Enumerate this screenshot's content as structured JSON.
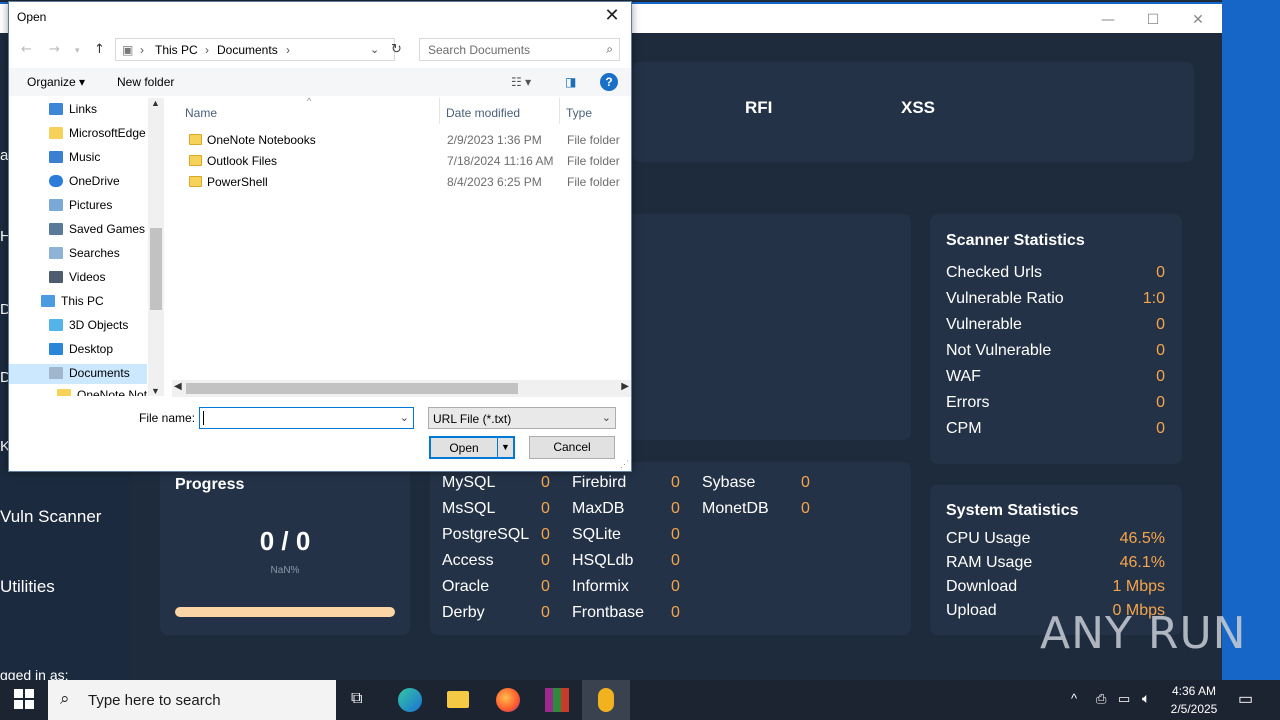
{
  "dialog": {
    "title": "Open",
    "address": [
      "This PC",
      "Documents"
    ],
    "search_placeholder": "Search Documents",
    "toolbar": {
      "organize": "Organize",
      "new_folder": "New folder"
    },
    "tree": [
      {
        "label": "Links",
        "icon": "links-icon"
      },
      {
        "label": "MicrosoftEdge",
        "icon": "folder-icon"
      },
      {
        "label": "Music",
        "icon": "music-icon"
      },
      {
        "label": "OneDrive",
        "icon": "onedrive-icon"
      },
      {
        "label": "Pictures",
        "icon": "pictures-icon"
      },
      {
        "label": "Saved Games",
        "icon": "saved-games-icon"
      },
      {
        "label": "Searches",
        "icon": "searches-icon"
      },
      {
        "label": "Videos",
        "icon": "videos-icon"
      },
      {
        "label": "This PC",
        "icon": "this-pc-icon"
      },
      {
        "label": "3D Objects",
        "icon": "3d-objects-icon"
      },
      {
        "label": "Desktop",
        "icon": "desktop-icon"
      },
      {
        "label": "Documents",
        "icon": "documents-icon"
      },
      {
        "label": "OneNote Not",
        "icon": "folder-icon"
      }
    ],
    "columns": {
      "name": "Name",
      "date": "Date modified",
      "type": "Type"
    },
    "files": [
      {
        "name": "OneNote Notebooks",
        "date": "2/9/2023 1:36 PM",
        "type": "File folder"
      },
      {
        "name": "Outlook Files",
        "date": "7/18/2024 11:16 AM",
        "type": "File folder"
      },
      {
        "name": "PowerShell",
        "date": "8/4/2023 6:25 PM",
        "type": "File folder"
      }
    ],
    "file_name_label": "File name:",
    "file_name_value": "",
    "filter": "URL File (*.txt)",
    "open_label": "Open",
    "cancel_label": "Cancel"
  },
  "app": {
    "tabs": [
      "RFI",
      "XSS"
    ],
    "sidebar": {
      "vuln_scanner": "Vuln Scanner",
      "utilities": "Utilities",
      "logged_in": "gged in as:"
    },
    "scanner_stats": {
      "title": "Scanner Statistics",
      "rows": [
        {
          "label": "Checked Urls",
          "value": "0"
        },
        {
          "label": "Vulnerable Ratio",
          "value": "1:0"
        },
        {
          "label": "Vulnerable",
          "value": "0"
        },
        {
          "label": "Not Vulnerable",
          "value": "0"
        },
        {
          "label": "WAF",
          "value": "0"
        },
        {
          "label": "Errors",
          "value": "0"
        },
        {
          "label": "CPM",
          "value": "0"
        }
      ]
    },
    "system_stats": {
      "title": "System Statistics",
      "rows": [
        {
          "label": "CPU Usage",
          "value": "46.5%"
        },
        {
          "label": "RAM Usage",
          "value": "46.1%"
        },
        {
          "label": "Download",
          "value": "1 Mbps"
        },
        {
          "label": "Upload",
          "value": "0 Mbps"
        }
      ]
    },
    "progress": {
      "title": "Progress",
      "count": "0 / 0",
      "percent": "NaN%"
    },
    "databases": [
      {
        "label": "MySQL",
        "value": "0"
      },
      {
        "label": "MsSQL",
        "value": "0"
      },
      {
        "label": "PostgreSQL",
        "value": "0"
      },
      {
        "label": "Access",
        "value": "0"
      },
      {
        "label": "Oracle",
        "value": "0"
      },
      {
        "label": "Derby",
        "value": "0"
      },
      {
        "label": "Firebird",
        "value": "0"
      },
      {
        "label": "MaxDB",
        "value": "0"
      },
      {
        "label": "SQLite",
        "value": "0"
      },
      {
        "label": "HSQLdb",
        "value": "0"
      },
      {
        "label": "Informix",
        "value": "0"
      },
      {
        "label": "Frontbase",
        "value": "0"
      },
      {
        "label": "Sybase",
        "value": "0"
      },
      {
        "label": "MonetDB",
        "value": "0"
      }
    ]
  },
  "taskbar": {
    "search_placeholder": "Type here to search",
    "time": "4:36 AM",
    "date": "2/5/2025"
  },
  "watermark": "ANY RUN",
  "colors": {
    "accent": "#0078d7",
    "stat_value": "#f5a54a",
    "app_bg": "#1d2b3d"
  }
}
